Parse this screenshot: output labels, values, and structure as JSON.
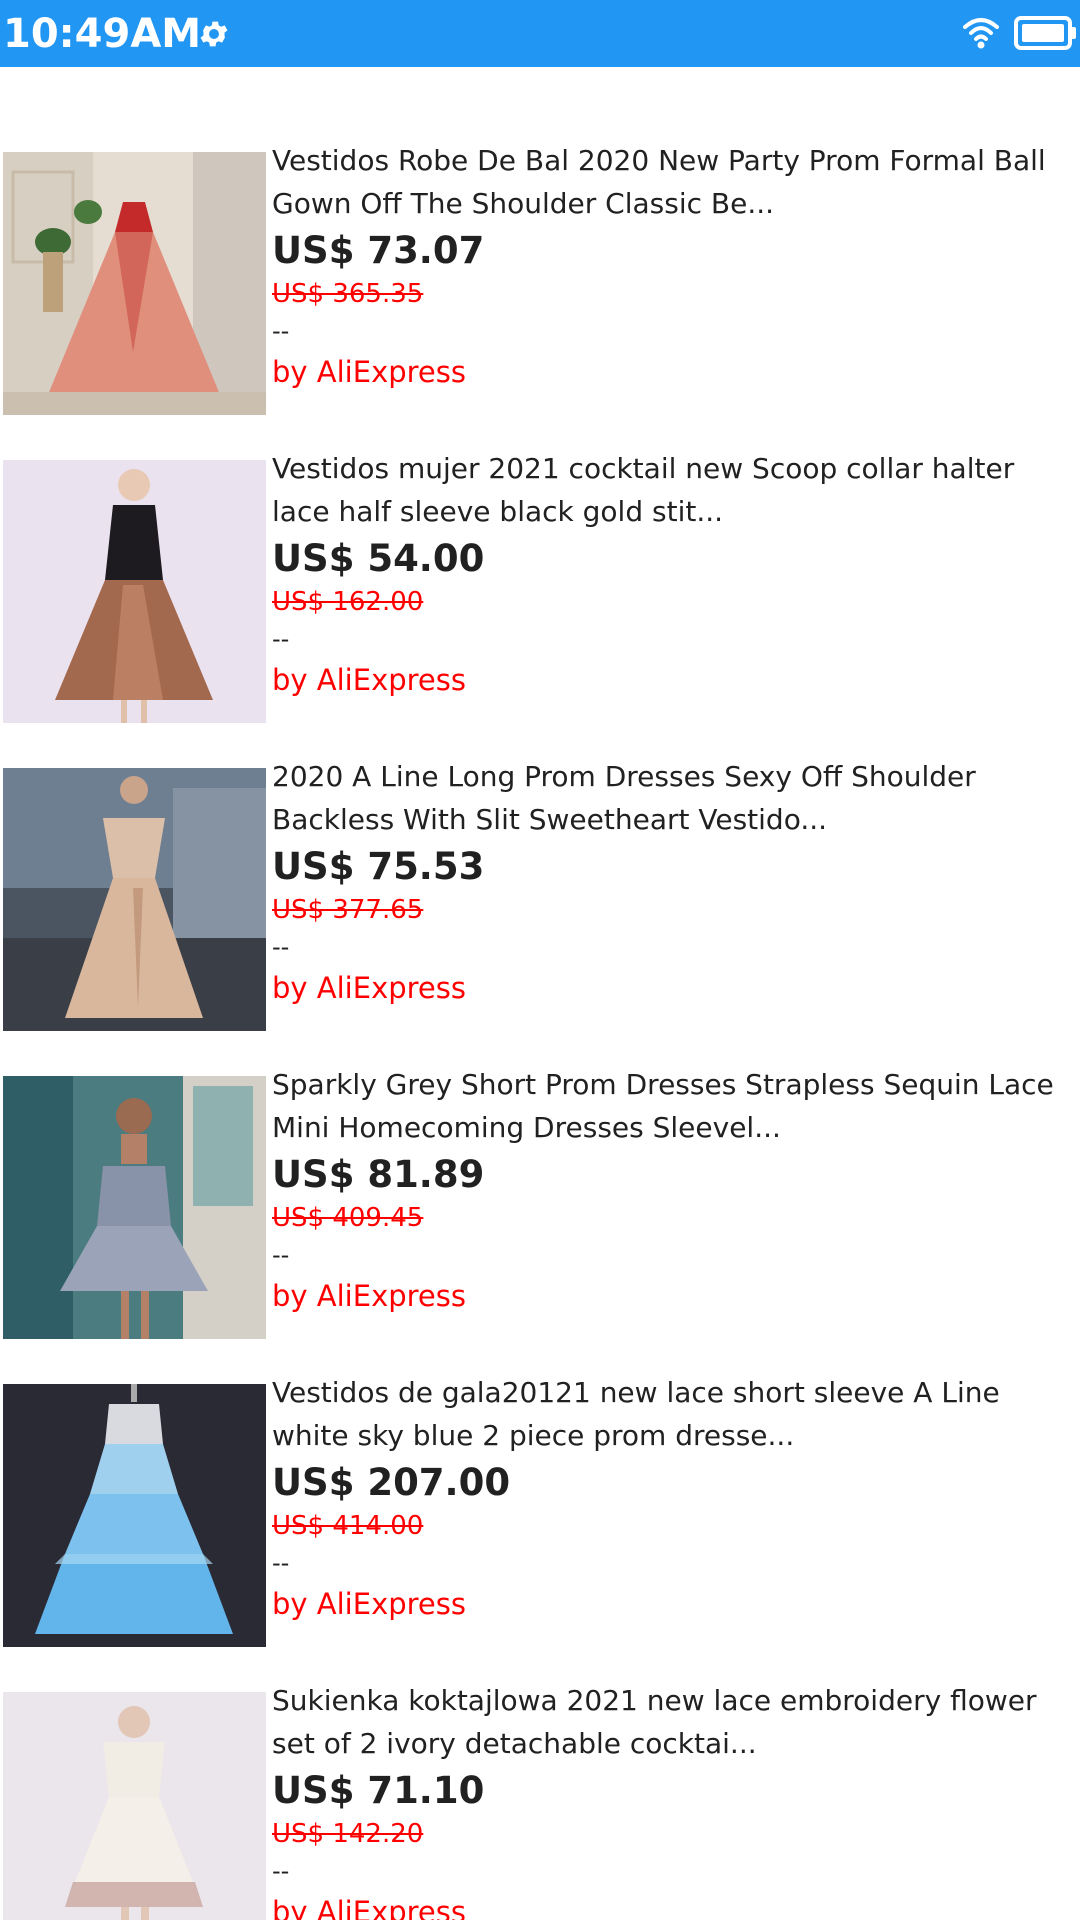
{
  "status_bar": {
    "time": "10:49AM",
    "background_color": "#2196F3",
    "icons": [
      "gear-icon",
      "wifi-icon",
      "battery-icon"
    ]
  },
  "accent_colors": {
    "sale_red": "#ff0000",
    "text_dark": "#212121"
  },
  "products": [
    {
      "title": "Vestidos Robe De Bal 2020 New Party Prom Formal Ball Gown Off The Shoulder Classic Be...",
      "price": "US$ 73.07",
      "old_price": "US$ 365.35",
      "rating": "--",
      "seller": "by AliExpress"
    },
    {
      "title": "Vestidos mujer 2021 cocktail new Scoop collar halter lace half sleeve black gold stit...",
      "price": "US$ 54.00",
      "old_price": "US$ 162.00",
      "rating": "--",
      "seller": "by AliExpress"
    },
    {
      "title": "2020 A Line Long Prom Dresses Sexy Off Shoulder Backless With Slit Sweetheart Vestido...",
      "price": "US$ 75.53",
      "old_price": "US$ 377.65",
      "rating": "--",
      "seller": "by AliExpress"
    },
    {
      "title": "Sparkly Grey Short Prom Dresses Strapless Sequin Lace Mini Homecoming Dresses Sleevel...",
      "price": "US$ 81.89",
      "old_price": "US$ 409.45",
      "rating": "--",
      "seller": "by AliExpress"
    },
    {
      "title": "Vestidos de gala20121 new lace short sleeve A Line white sky blue 2 piece prom dresse...",
      "price": "US$ 207.00",
      "old_price": "US$ 414.00",
      "rating": "--",
      "seller": "by AliExpress"
    },
    {
      "title": "Sukienka koktajlowa 2021 new lace embroidery flower set of 2 ivory detachable cocktai...",
      "price": "US$ 71.10",
      "old_price": "US$ 142.20",
      "rating": "--",
      "seller": "by AliExpress"
    }
  ]
}
